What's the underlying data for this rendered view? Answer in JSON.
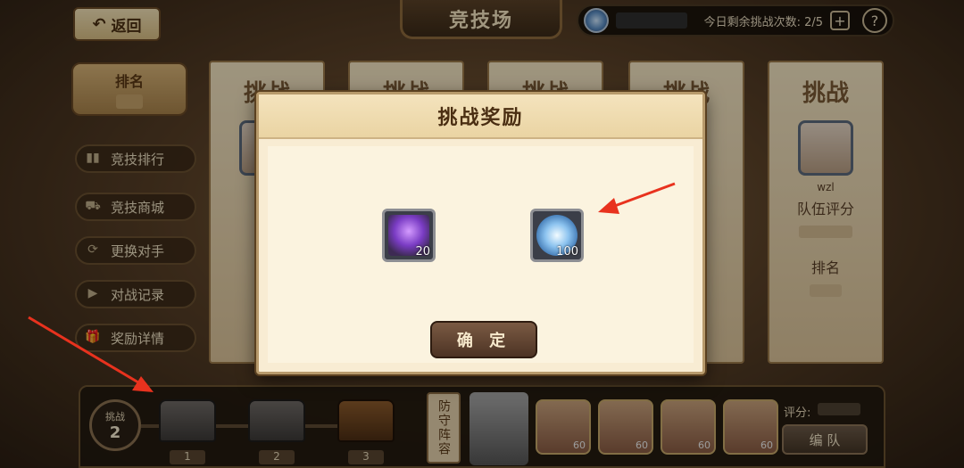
{
  "header": {
    "back_label": "返回",
    "title": "竞技场",
    "attempts_text": "今日剩余挑战次数: 2/5",
    "plus_label": "+",
    "help_label": "?"
  },
  "left_panel": {
    "rank_label": "排名",
    "menu": [
      {
        "label": "竞技排行",
        "icon": "bar-chart-icon"
      },
      {
        "label": "竞技商城",
        "icon": "cart-icon"
      },
      {
        "label": "更换对手",
        "icon": "refresh-icon"
      },
      {
        "label": "对战记录",
        "icon": "play-icon"
      },
      {
        "label": "奖励详情",
        "icon": "gift-icon"
      }
    ]
  },
  "opponents": [
    {
      "badge": "挑战"
    },
    {
      "badge": "挑战"
    },
    {
      "badge": "挑战"
    },
    {
      "badge": "挑战"
    },
    {
      "badge": "挑战",
      "name": "wzl",
      "score_label": "队伍评分",
      "rank_label": "排名"
    }
  ],
  "modal": {
    "title": "挑战奖励",
    "rewards": [
      {
        "icon": "purple-flower-icon",
        "qty": "20"
      },
      {
        "icon": "blue-gem-coin-icon",
        "qty": "100"
      }
    ],
    "confirm_label": "确 定"
  },
  "bottom": {
    "challenge_label": "挑战",
    "challenge_count": "2",
    "chests": [
      "1",
      "2",
      "3"
    ],
    "defense_label": "防守阵容",
    "hero_levels": [
      "60",
      "60",
      "60",
      "60"
    ],
    "score_label": "评分:",
    "edit_team_label": "编 队"
  },
  "colors": {
    "annotation_arrow": "#e8321e",
    "modal_bg": "#f8ecd3",
    "confirm_bg": "#5f4331"
  }
}
